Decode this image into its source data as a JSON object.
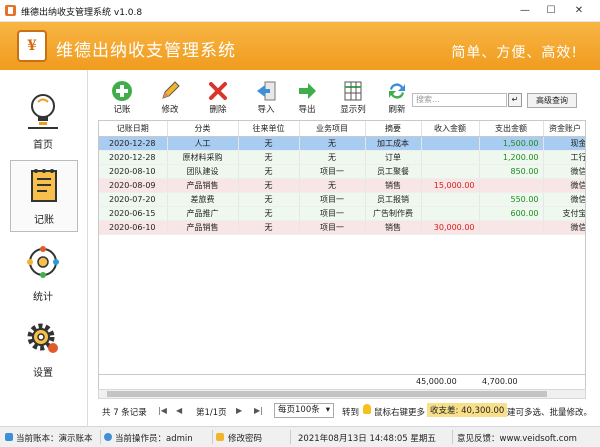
{
  "window": {
    "title": "维德出纳收支管理系统  v1.0.8",
    "controls": [
      "minimize-icon",
      "maximize-icon",
      "close-icon"
    ]
  },
  "banner": {
    "logo_glyph": "¥",
    "app_name": "维德出纳收支管理系统",
    "slogan": "简单、方便、高效!"
  },
  "nav": {
    "items": [
      {
        "label": "首页",
        "icon": "home-lightbulb-icon",
        "active": false
      },
      {
        "label": "记账",
        "icon": "ledger-icon",
        "active": true
      },
      {
        "label": "统计",
        "icon": "statistics-icon",
        "active": false
      },
      {
        "label": "设置",
        "icon": "settings-gear-icon",
        "active": false
      }
    ]
  },
  "toolbar": {
    "buttons": [
      {
        "label": "记账",
        "icon": "add-icon"
      },
      {
        "label": "修改",
        "icon": "edit-icon"
      },
      {
        "label": "删除",
        "icon": "delete-icon"
      },
      {
        "label": "导入",
        "icon": "import-icon"
      },
      {
        "label": "导出",
        "icon": "export-icon"
      },
      {
        "label": "显示列",
        "icon": "columns-icon"
      },
      {
        "label": "刷新",
        "icon": "refresh-icon"
      }
    ],
    "search_placeholder": "搜索...",
    "search_go": "↵",
    "advanced_search": "高级查询"
  },
  "table": {
    "columns": [
      "记账日期",
      "分类",
      "往来单位",
      "业务项目",
      "摘要",
      "收入金额",
      "支出金额",
      "资金账户"
    ],
    "rows": [
      {
        "date": "2020-12-28",
        "category": "人工",
        "partner": "无",
        "project": "无",
        "summary": "加工成本",
        "income": "",
        "expense": "1,500.00",
        "account": "现金",
        "type": "sel"
      },
      {
        "date": "2020-12-28",
        "category": "原材料采购",
        "partner": "无",
        "project": "无",
        "summary": "订单",
        "income": "",
        "expense": "1,200.00",
        "account": "工行",
        "type": "expense"
      },
      {
        "date": "2020-08-10",
        "category": "团队建设",
        "partner": "无",
        "project": "项目一",
        "summary": "员工聚餐",
        "income": "",
        "expense": "850.00",
        "account": "微信",
        "type": "expense"
      },
      {
        "date": "2020-08-09",
        "category": "产品销售",
        "partner": "无",
        "project": "无",
        "summary": "销售",
        "income": "15,000.00",
        "expense": "",
        "account": "微信",
        "type": "income"
      },
      {
        "date": "2020-07-20",
        "category": "差旅费",
        "partner": "无",
        "project": "项目一",
        "summary": "员工报销",
        "income": "",
        "expense": "550.00",
        "account": "微信",
        "type": "expense"
      },
      {
        "date": "2020-06-15",
        "category": "产品推广",
        "partner": "无",
        "project": "项目一",
        "summary": "广告制作费",
        "income": "",
        "expense": "600.00",
        "account": "支付宝",
        "type": "expense"
      },
      {
        "date": "2020-06-10",
        "category": "产品销售",
        "partner": "无",
        "project": "项目一",
        "summary": "销售",
        "income": "30,000.00",
        "expense": "",
        "account": "微信",
        "type": "income"
      }
    ],
    "total_income": "45,000.00",
    "total_expense": "4,700.00"
  },
  "pager": {
    "record_count": "共 7 条记录",
    "page_info": "第1/1页",
    "page_size": "每页100条",
    "goto_label": "转到",
    "tip_before": "鼠标右键更多",
    "balance": "收支差: 40,300.00",
    "tip_after": "建可多选、批量修改。"
  },
  "status": {
    "account": "当前账本：演示账本",
    "operator": "当前操作员：admin",
    "change_password": "修改密码",
    "datetime": "2021年08月13日 14:48:05 星期五",
    "feedback": "意见反馈：www.veidsoft.com"
  },
  "colors": {
    "banner": "#f09c1e",
    "selected_row": "#a9cdf2",
    "income_row": "#f8e6e6",
    "expense_row": "#eef8ee",
    "income_text": "#d61c1c",
    "expense_text": "#1f8a1f"
  }
}
